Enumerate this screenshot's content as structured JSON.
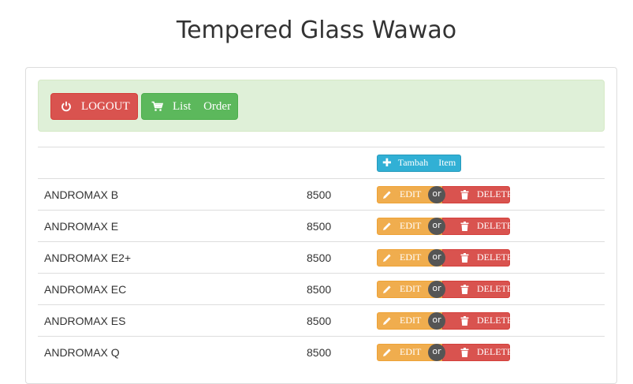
{
  "page": {
    "title": "Tempered Glass Wawao"
  },
  "toolbar": {
    "logout_label": "LOGOUT",
    "list_order_label": "List Order",
    "logout_icon": "power-icon",
    "list_order_icon": "cart-icon"
  },
  "table": {
    "add_item_label": "Tambah Item",
    "add_item_icon": "plus-icon",
    "edit_label": "EDIT",
    "delete_label": "DELETE",
    "or_label": "or",
    "rows": [
      {
        "name": "ANDROMAX B",
        "price": "8500"
      },
      {
        "name": "ANDROMAX E",
        "price": "8500"
      },
      {
        "name": "ANDROMAX E2+",
        "price": "8500"
      },
      {
        "name": "ANDROMAX EC",
        "price": "8500"
      },
      {
        "name": "ANDROMAX ES",
        "price": "8500"
      },
      {
        "name": "ANDROMAX Q",
        "price": "8500"
      }
    ]
  },
  "colors": {
    "danger": "#d9534f",
    "success": "#5cb85c",
    "warning": "#f0ad4e",
    "info": "#31b0d5",
    "alert_bg": "#dff0d8"
  }
}
